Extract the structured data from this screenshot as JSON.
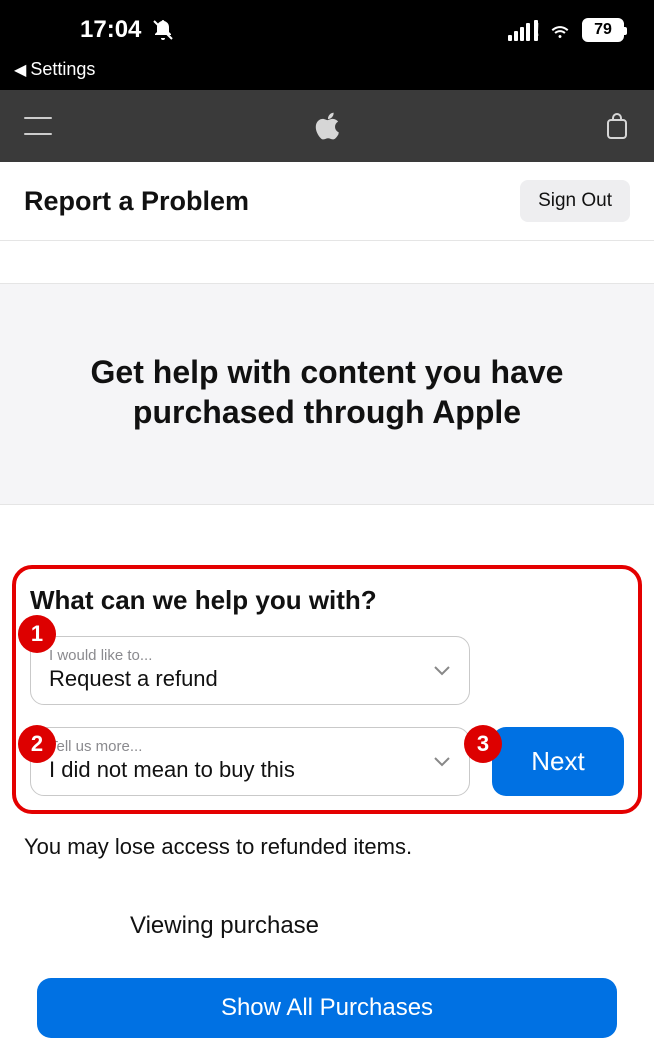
{
  "status": {
    "time": "17:04",
    "back_label": "Settings",
    "battery_pct": "79"
  },
  "header": {
    "title": "Report a Problem",
    "signout_label": "Sign Out"
  },
  "hero": {
    "heading": "Get help with content you have purchased through Apple"
  },
  "form": {
    "heading": "What can we help you with?",
    "select1": {
      "label": "I would like to...",
      "value": "Request a refund"
    },
    "select2": {
      "label": "Tell us more...",
      "value": "I did not mean to buy this"
    },
    "next_label": "Next",
    "markers": {
      "m1": "1",
      "m2": "2",
      "m3": "3"
    }
  },
  "notes": {
    "refund_warning": "You may lose access to refunded items.",
    "viewing": "Viewing purchase",
    "show_all_label": "Show All Purchases"
  }
}
